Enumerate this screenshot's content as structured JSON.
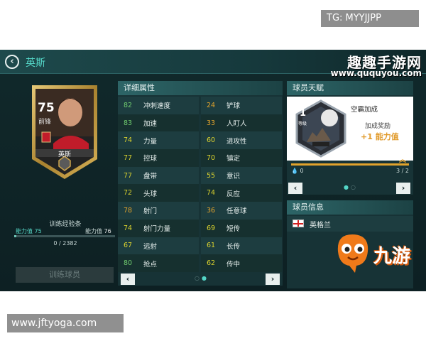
{
  "watermarks": {
    "tg": "TG: MYYJJPP",
    "site": "www.jftyoga.com",
    "qq_cn": "趣趣手游网",
    "qq_url": "www.ququyou.com",
    "jy": "九游"
  },
  "header": {
    "back_icon": "chevron-left-icon",
    "title": "英斯"
  },
  "card": {
    "rating": "75",
    "position": "前锋",
    "name": "英斯",
    "colors": {
      "gold": "#c9a24a",
      "dark": "#1c1c1c"
    }
  },
  "training": {
    "label": "训练经验条",
    "left_label": "能力值",
    "left_value": "75",
    "right_label": "能力值",
    "right_value": "76",
    "progress_text": "0 / 2382",
    "progress": 0.02,
    "button": "训练球员"
  },
  "attributes": {
    "title": "详细属性",
    "left": [
      {
        "value": "82",
        "name": "冲刺速度",
        "tone": "green"
      },
      {
        "value": "83",
        "name": "加速",
        "tone": "green"
      },
      {
        "value": "74",
        "name": "力量",
        "tone": "yellow"
      },
      {
        "value": "77",
        "name": "控球",
        "tone": "yellow"
      },
      {
        "value": "77",
        "name": "盘带",
        "tone": "yellow"
      },
      {
        "value": "72",
        "name": "头球",
        "tone": "yellow"
      },
      {
        "value": "78",
        "name": "射门",
        "tone": "orange"
      },
      {
        "value": "74",
        "name": "射门力量",
        "tone": "yellow"
      },
      {
        "value": "67",
        "name": "远射",
        "tone": "yellow"
      },
      {
        "value": "80",
        "name": "抢点",
        "tone": "green"
      }
    ],
    "right": [
      {
        "value": "24",
        "name": "铲球",
        "tone": "orange"
      },
      {
        "value": "33",
        "name": "人盯人",
        "tone": "orange"
      },
      {
        "value": "60",
        "name": "进攻性",
        "tone": "yellow"
      },
      {
        "value": "70",
        "name": "镇定",
        "tone": "yellow"
      },
      {
        "value": "55",
        "name": "意识",
        "tone": "yellow"
      },
      {
        "value": "74",
        "name": "反应",
        "tone": "yellow"
      },
      {
        "value": "36",
        "name": "任意球",
        "tone": "orange"
      },
      {
        "value": "69",
        "name": "短传",
        "tone": "yellow"
      },
      {
        "value": "61",
        "name": "长传",
        "tone": "yellow"
      },
      {
        "value": "62",
        "name": "传中",
        "tone": "yellow"
      }
    ],
    "prev_icon": "chevron-left-icon",
    "next_icon": "chevron-right-icon",
    "page": 2,
    "pages": 2
  },
  "talent": {
    "title": "球员天赋",
    "level": "1",
    "level_sub": "等级",
    "skill_name": "空霸加成",
    "reward_label": "加成奖励",
    "reward_value": "+1 能力值",
    "drops": "0",
    "count": "3 / 2",
    "progress": 1.0,
    "page": 1,
    "pages": 2
  },
  "info": {
    "title": "球员信息",
    "nation": "英格兰"
  },
  "colors": {
    "accent": "#54d6c7",
    "yellow": "#d9d12f",
    "green": "#6fca6e",
    "orange": "#e1a32c",
    "bg": "#11292b"
  }
}
